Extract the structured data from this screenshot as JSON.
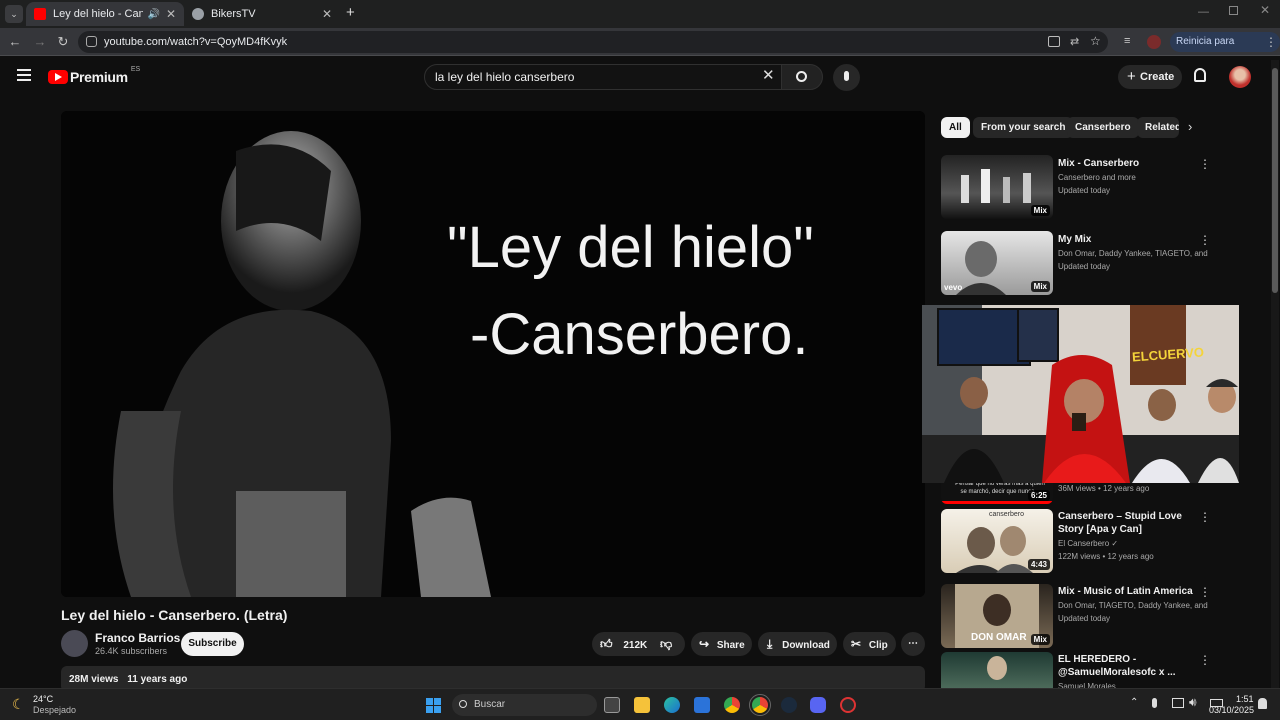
{
  "browser": {
    "tabs": [
      {
        "label": "Ley del hielo - Canserbero.",
        "active": true,
        "color": "#ff0000"
      },
      {
        "label": "BikersTV",
        "active": false,
        "color": "#9aa0a6"
      }
    ],
    "url": "youtube.com/watch?v=QoyMD4fKvyk",
    "update_button": "Reinicia para actualizar"
  },
  "yt": {
    "brand": "Premium",
    "region": "ES",
    "search_value": "la ley del hielo canserbero",
    "create_label": "Create"
  },
  "video": {
    "overlay_line1": "\"Ley del hielo\"",
    "overlay_line2": "-Canserbero.",
    "title": "Ley del hielo - Canserbero. (Letra)",
    "channel": "Franco Barrios",
    "subscribers": "26.4K subscribers",
    "subscribe_label": "Subscribe",
    "likes": "212K",
    "share_label": "Share",
    "download_label": "Download",
    "clip_label": "Clip",
    "views": "28M views",
    "age": "11 years ago"
  },
  "chips": [
    "All",
    "From your search",
    "Canserbero",
    "Related"
  ],
  "recs": [
    {
      "title": "Mix - Canserbero",
      "meta1": "Canserbero and more",
      "meta2": "Updated today",
      "badge": "Mix"
    },
    {
      "title": "My Mix",
      "meta1": "Don Omar, Daddy Yankee, TIAGETO, and ...",
      "meta2": "Updated today",
      "badge": "Mix",
      "thumb_logo": "vevo"
    },
    {
      "title": "",
      "meta1": "",
      "meta2": "36M views • 12 years ago",
      "badge": "6:25",
      "caption": "Pensar que no verás más a quien se marchó, decir que nunca..."
    },
    {
      "title": "Canserbero – Stupid Love Story [Apa y Can]",
      "meta1": "El Canserbero",
      "meta2": "122M views • 12 years ago",
      "badge": "4:43",
      "thumb_text": "canserbero"
    },
    {
      "title": "Mix - Music of Latin America",
      "meta1": "Don Omar, TIAGETO, Daddy Yankee, and ...",
      "meta2": "Updated today",
      "badge": "Mix",
      "thumb_text": "DON OMAR"
    },
    {
      "title": "EL HEREDERO - @SamuelMoralesofc x ...",
      "meta1": "Samuel Morales",
      "meta2": "",
      "badge": ""
    }
  ],
  "overlay_cam": {
    "poster_text": "ELCUERVO"
  },
  "taskbar": {
    "weather_temp": "24°C",
    "weather_desc": "Despejado",
    "search_placeholder": "Buscar",
    "time": "1:51",
    "date": "03/10/2025"
  },
  "colors": {
    "yt_red": "#ff0000",
    "bg": "#0f0f0f",
    "chip": "#272727"
  }
}
